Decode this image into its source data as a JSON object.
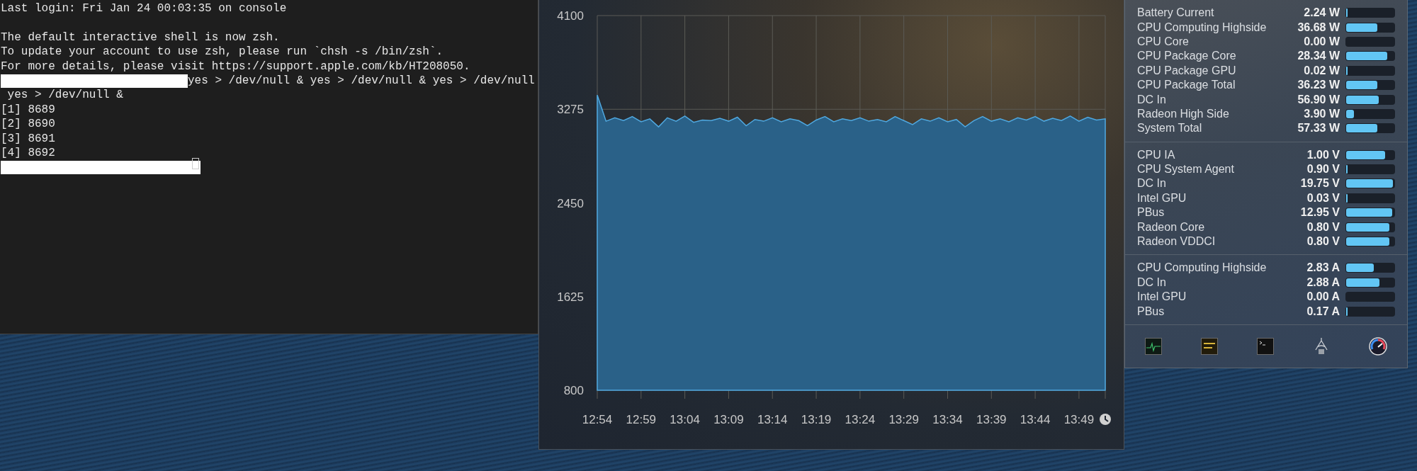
{
  "terminal": {
    "lines": [
      {
        "kind": "text",
        "text": "Last login: Fri Jan 24 00:03:35 on console"
      },
      {
        "kind": "blank"
      },
      {
        "kind": "text",
        "text": "The default interactive shell is now zsh."
      },
      {
        "kind": "text",
        "text": "To update your account to use zsh, please run `chsh -s /bin/zsh`."
      },
      {
        "kind": "text",
        "text": "For more details, please visit https://support.apple.com/kb/HT208050."
      },
      {
        "kind": "redacted_text",
        "text": "yes > /dev/null & yes > /dev/null & yes > /dev/null"
      },
      {
        "kind": "text",
        "text": " yes > /dev/null &"
      },
      {
        "kind": "text",
        "text": "[1] 8689"
      },
      {
        "kind": "text",
        "text": "[2] 8690"
      },
      {
        "kind": "text",
        "text": "[3] 8691"
      },
      {
        "kind": "text",
        "text": "[4] 8692"
      },
      {
        "kind": "redacted_prompt"
      }
    ]
  },
  "chart_window": {
    "chart_data": {
      "type": "area",
      "grid": true,
      "ylim": [
        800,
        4100
      ],
      "yticks": [
        800,
        1625,
        2450,
        3275,
        4100
      ],
      "categories": [
        "12:54",
        null,
        null,
        null,
        null,
        "12:59",
        null,
        null,
        null,
        null,
        "13:04",
        null,
        null,
        null,
        null,
        "13:09",
        null,
        null,
        null,
        null,
        "13:14",
        null,
        null,
        null,
        null,
        "13:19",
        null,
        null,
        null,
        null,
        "13:24",
        null,
        null,
        null,
        null,
        "13:29",
        null,
        null,
        null,
        null,
        "13:34",
        null,
        null,
        null,
        null,
        "13:39",
        null,
        null,
        null,
        null,
        "13:44",
        null,
        null,
        null,
        null,
        "13:49",
        null,
        null,
        null
      ],
      "series": [
        {
          "color": "#4fa8e0",
          "values": [
            3400,
            3170,
            3200,
            3175,
            3210,
            3165,
            3190,
            3120,
            3200,
            3170,
            3215,
            3160,
            3180,
            3175,
            3195,
            3170,
            3205,
            3130,
            3185,
            3170,
            3200,
            3165,
            3190,
            3175,
            3130,
            3180,
            3210,
            3165,
            3190,
            3175,
            3200,
            3170,
            3185,
            3165,
            3210,
            3175,
            3140,
            3190,
            3170,
            3200,
            3165,
            3185,
            3120,
            3175,
            3210,
            3170,
            3190,
            3165,
            3200,
            3180,
            3210,
            3170,
            3195,
            3175,
            3215,
            3170,
            3205,
            3180,
            3190
          ]
        }
      ]
    }
  },
  "sensors": {
    "sections": [
      {
        "rows": [
          {
            "label": "Battery Current",
            "value": "2.24 W",
            "level": 0.02
          },
          {
            "label": "CPU Computing Highside",
            "value": "36.68 W",
            "level": 0.64
          },
          {
            "label": "CPU Core",
            "value": "0.00 W"
          },
          {
            "label": "CPU Package Core",
            "value": "28.34 W",
            "level": 0.85
          },
          {
            "label": "CPU Package GPU",
            "value": "0.02 W",
            "level": 0.01
          },
          {
            "label": "CPU Package Total",
            "value": "36.23 W",
            "level": 0.64
          },
          {
            "label": "DC In",
            "value": "56.90 W",
            "level": 0.68
          },
          {
            "label": "Radeon High Side",
            "value": "3.90 W",
            "level": 0.16
          },
          {
            "label": "System Total",
            "value": "57.33 W",
            "level": 0.64
          }
        ]
      },
      {
        "rows": [
          {
            "label": "CPU IA",
            "value": "1.00 V",
            "level": 0.81
          },
          {
            "label": "CPU System Agent",
            "value": "0.90 V",
            "level": 0.02
          },
          {
            "label": "DC In",
            "value": "19.75 V",
            "level": 0.97
          },
          {
            "label": "Intel GPU",
            "value": "0.03 V",
            "level": 0.01
          },
          {
            "label": "PBus",
            "value": "12.95 V",
            "level": 0.96
          },
          {
            "label": "Radeon Core",
            "value": "0.80 V",
            "level": 0.89
          },
          {
            "label": "Radeon VDDCI",
            "value": "0.80 V",
            "level": 0.89
          }
        ]
      },
      {
        "rows": [
          {
            "label": "CPU Computing Highside",
            "value": "2.83 A",
            "level": 0.57
          },
          {
            "label": "DC In",
            "value": "2.88 A",
            "level": 0.69
          },
          {
            "label": "Intel GPU",
            "value": "0.00 A"
          },
          {
            "label": "PBus",
            "value": "0.17 A",
            "level": 0.01
          }
        ]
      }
    ]
  }
}
